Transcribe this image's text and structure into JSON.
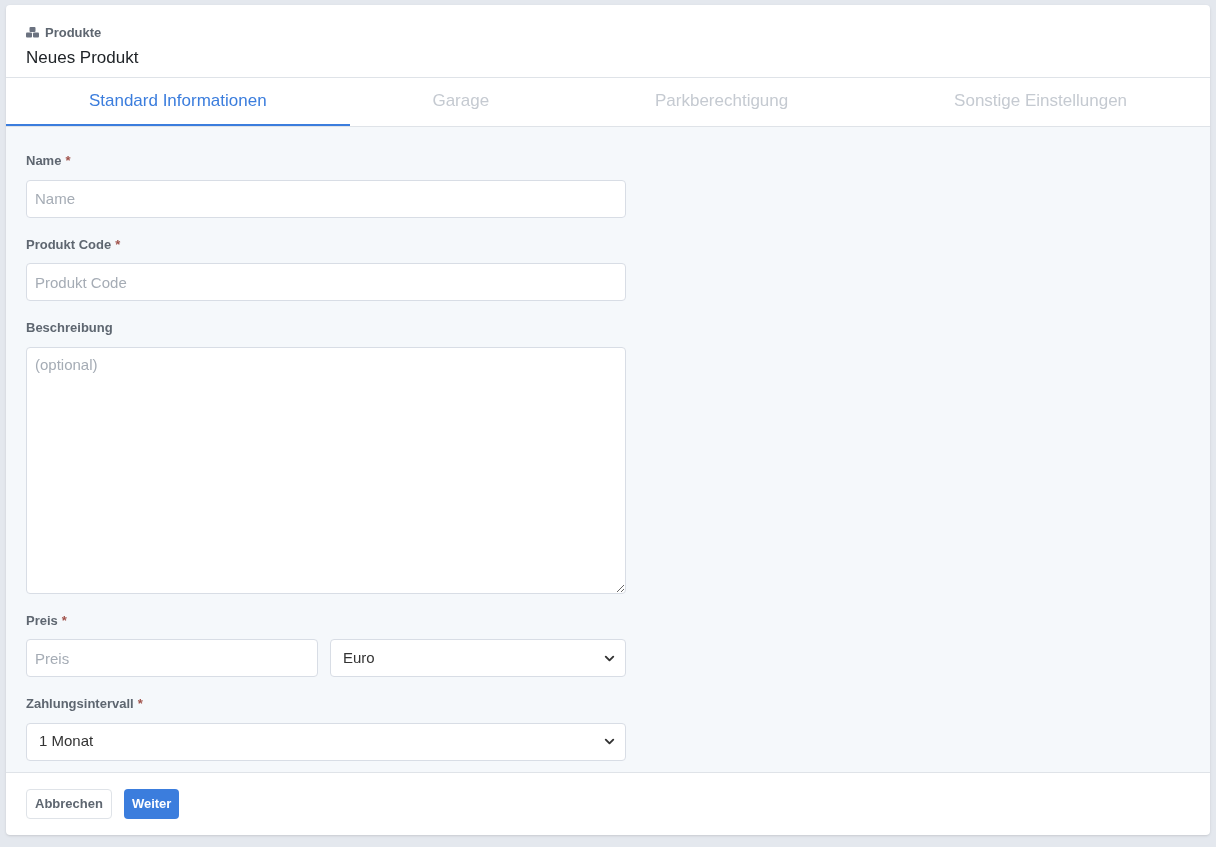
{
  "header": {
    "breadcrumb": "Produkte",
    "title": "Neues Produkt"
  },
  "tabs": [
    {
      "label": "Standard Informationen",
      "selected": true
    },
    {
      "label": "Garage",
      "selected": false
    },
    {
      "label": "Parkberechtigung",
      "selected": false
    },
    {
      "label": "Sonstige Einstellungen",
      "selected": false
    }
  ],
  "fields": [
    {
      "label": "Name",
      "mark": "*",
      "controls": [
        {
          "kind": "input",
          "placeholder": "Name"
        }
      ]
    },
    {
      "label": "Produkt Code",
      "mark": "*",
      "controls": [
        {
          "kind": "input",
          "placeholder": "Produkt Code"
        }
      ]
    },
    {
      "label": "Beschreibung",
      "controls": [
        {
          "kind": "textarea",
          "placeholder": "(optional)"
        }
      ]
    },
    {
      "label": "Preis",
      "mark": "*",
      "controls": [
        {
          "kind": "input",
          "placeholder": "Preis"
        },
        {
          "kind": "select",
          "value": "Euro"
        }
      ]
    },
    {
      "label": "Zahlungsintervall",
      "mark": "*",
      "controls": [
        {
          "kind": "select",
          "value": "1 Monat"
        }
      ]
    }
  ],
  "buttons": [
    {
      "label": "Abbrechen",
      "kind": "secondary"
    },
    {
      "label": "Weiter",
      "kind": "primary"
    }
  ]
}
